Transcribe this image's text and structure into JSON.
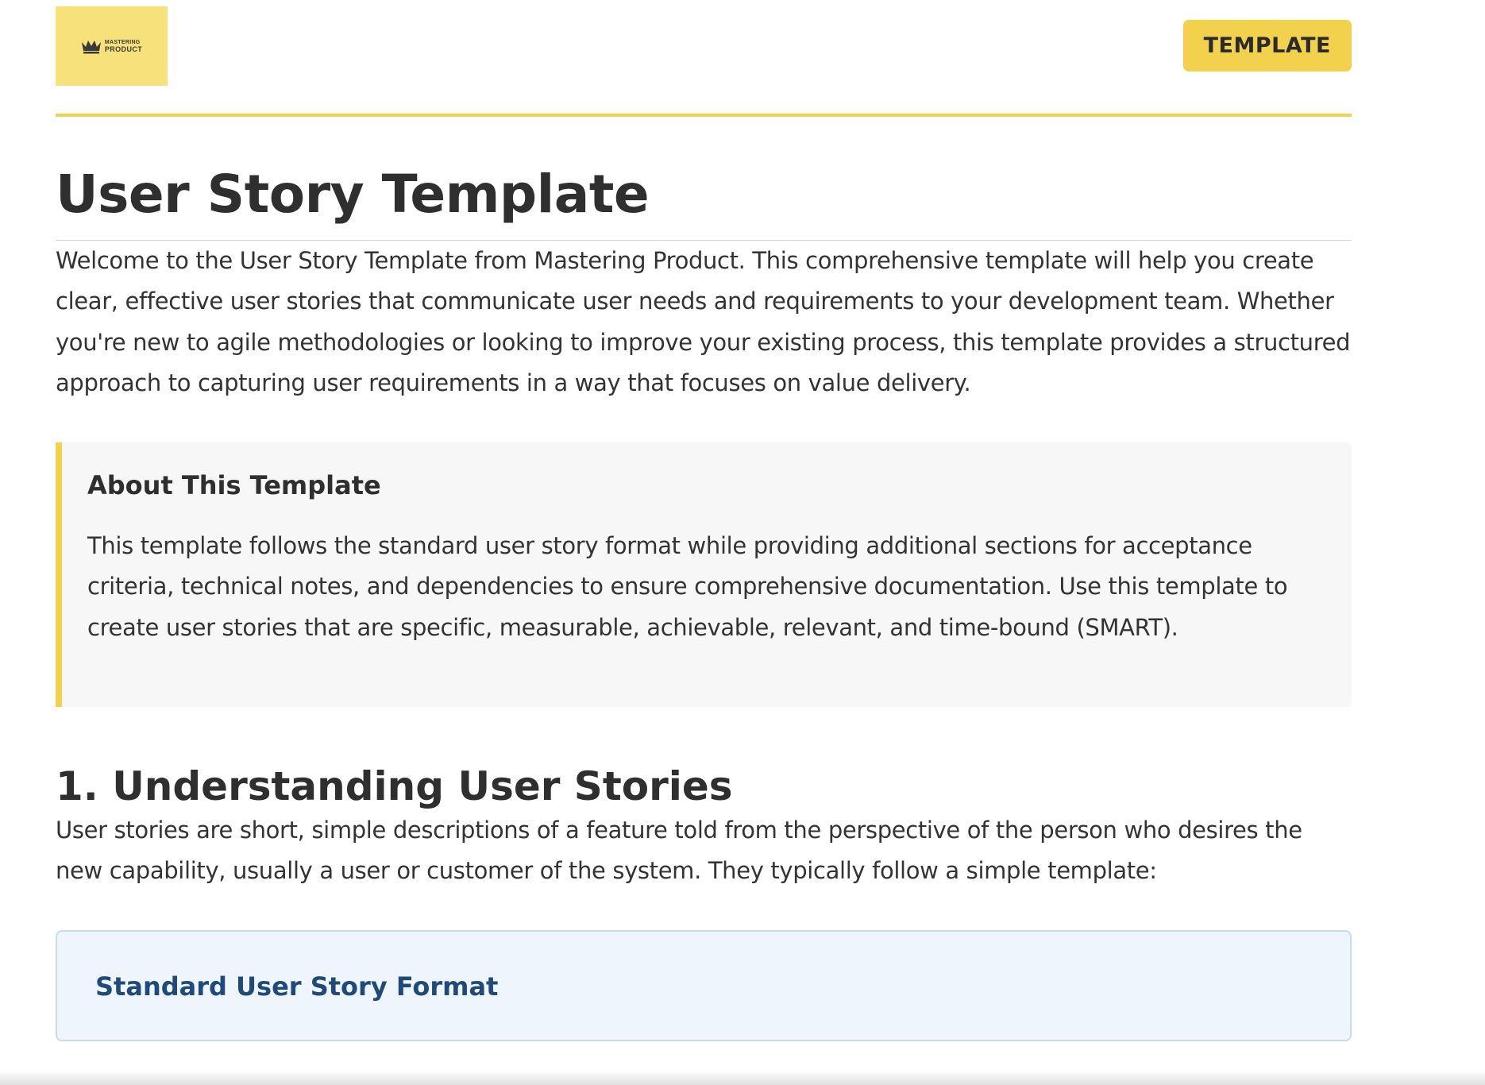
{
  "header": {
    "logo_line1": "MASTERING",
    "logo_line2": "PRODUCT",
    "badge": "TEMPLATE"
  },
  "title": "User Story Template",
  "intro": "Welcome to the User Story Template from Mastering Product. This comprehensive template will help you create clear, effective user stories that communicate user needs and requirements to your development team. Whether you're new to agile methodologies or looking to improve your existing process, this template provides a structured approach to capturing user requirements in a way that focuses on value delivery.",
  "callout": {
    "heading": "About This Template",
    "text": "This template follows the standard user story format while providing additional sections for acceptance criteria, technical notes, and dependencies to ensure comprehensive documentation. Use this template to create user stories that are specific, measurable, achievable, relevant, and time-bound (SMART)."
  },
  "section1": {
    "title": "1. Understanding User Stories",
    "text": "User stories are short, simple descriptions of a feature told from the perspective of the person who desires the new capability, usually a user or customer of the system. They typically follow a simple template:",
    "format_box_title": "Standard User Story Format"
  },
  "colors": {
    "accent": "#f2d24c",
    "logo_bg": "#f7e17a",
    "callout_bg": "#f7f7f7",
    "format_box_bg": "#eef5fd",
    "format_title": "#1f4a7a"
  }
}
